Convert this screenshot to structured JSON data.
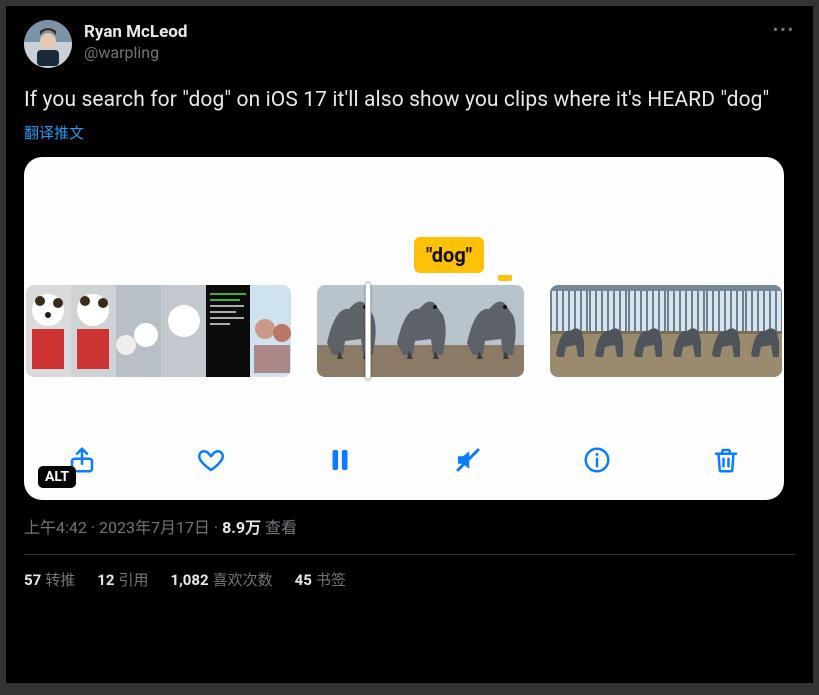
{
  "user": {
    "display_name": "Ryan McLeod",
    "handle": "@warpling"
  },
  "more_label": "•••",
  "tweet_text": "If you search for \"dog\" on iOS 17 it'll also show you clips where it's HEARD \"dog\"",
  "translate_label": "翻译推文",
  "media": {
    "chip_text": "\"dog\"",
    "alt_badge": "ALT",
    "icons": {
      "share": "share-icon",
      "heart": "heart-icon",
      "pause": "pause-icon",
      "mute": "mute-icon",
      "info": "info-icon",
      "trash": "trash-icon"
    }
  },
  "meta": {
    "time": "上午4:42",
    "sep1": " · ",
    "date": "2023年7月17日",
    "sep2": " · ",
    "views_number": "8.9万",
    "views_label": " 查看"
  },
  "stats": {
    "retweets_n": "57",
    "retweets_l": "转推",
    "quotes_n": "12",
    "quotes_l": "引用",
    "likes_n": "1,082",
    "likes_l": "喜欢次数",
    "bookmarks_n": "45",
    "bookmarks_l": "书签"
  }
}
